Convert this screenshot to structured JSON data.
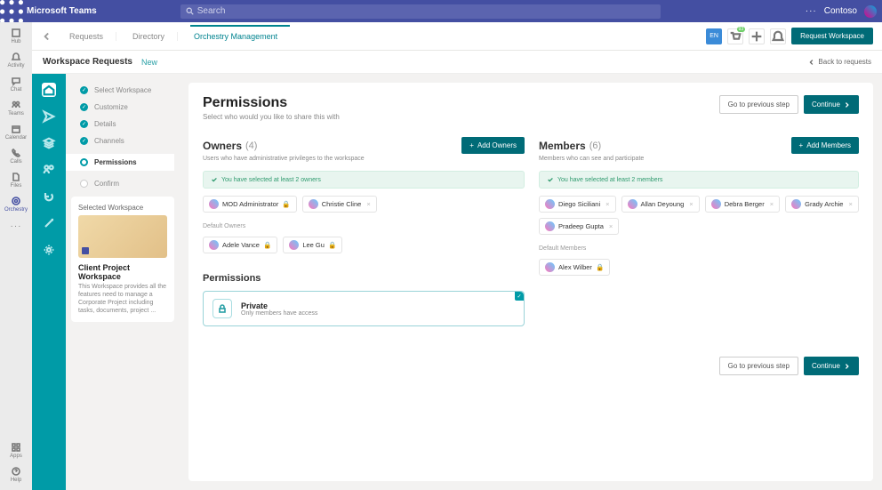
{
  "brand": "Microsoft Teams",
  "search_placeholder": "Search",
  "top_org": "Contoso",
  "rail": [
    {
      "k": "hub",
      "l": "Hub"
    },
    {
      "k": "activity",
      "l": "Activity"
    },
    {
      "k": "chat",
      "l": "Chat"
    },
    {
      "k": "teams",
      "l": "Teams"
    },
    {
      "k": "calendar",
      "l": "Calendar"
    },
    {
      "k": "calls",
      "l": "Calls"
    },
    {
      "k": "files",
      "l": "Files"
    },
    {
      "k": "orchestry",
      "l": "Orchestry"
    }
  ],
  "rail_bottom": [
    {
      "k": "apps",
      "l": "Apps"
    },
    {
      "k": "help",
      "l": "Help"
    }
  ],
  "tabs": {
    "requests": "Requests",
    "directory": "Directory",
    "active": "Orchestry Management"
  },
  "lang": "EN",
  "notif_badge": "93",
  "request_btn": "Request Workspace",
  "crumb": {
    "title": "Workspace Requests",
    "new": "New",
    "back": "Back to requests"
  },
  "steps": [
    {
      "l": "Select Workspace",
      "s": "done"
    },
    {
      "l": "Customize",
      "s": "done"
    },
    {
      "l": "Details",
      "s": "done"
    },
    {
      "l": "Channels",
      "s": "done"
    },
    {
      "l": "Permissions",
      "s": "current"
    },
    {
      "l": "Confirm",
      "s": "upcoming"
    }
  ],
  "selected": {
    "t": "Selected Workspace",
    "name": "Client Project Workspace",
    "desc": "This Workspace provides all the features need to manage a Corporate Project including tasks, documents, project ..."
  },
  "header": {
    "title": "Permissions",
    "sub": "Select who would you like to share this with",
    "prev": "Go to previous step",
    "cont": "Continue"
  },
  "owners": {
    "title": "Owners",
    "count": "(4)",
    "add": "Add Owners",
    "sub": "Users who have administrative privileges to the workspace",
    "banner": "You have selected at least 2 owners",
    "chips": [
      {
        "n": "MOD Administrator",
        "lock": true
      },
      {
        "n": "Christie Cline",
        "lock": false
      }
    ],
    "def_label": "Default Owners",
    "defaults": [
      {
        "n": "Adele Vance"
      },
      {
        "n": "Lee Gu"
      }
    ]
  },
  "members": {
    "title": "Members",
    "count": "(6)",
    "add": "Add Members",
    "sub": "Members who can see and participate",
    "banner": "You have selected at least 2 members",
    "chips": [
      {
        "n": "Diego Siciliani"
      },
      {
        "n": "Allan Deyoung"
      },
      {
        "n": "Debra Berger"
      },
      {
        "n": "Grady Archie"
      },
      {
        "n": "Pradeep Gupta"
      }
    ],
    "def_label": "Default Members",
    "defaults": [
      {
        "n": "Alex Wilber"
      }
    ]
  },
  "perm": {
    "section": "Permissions",
    "title": "Private",
    "sub": "Only members have access"
  },
  "footer": {
    "prev": "Go to previous step",
    "cont": "Continue"
  }
}
